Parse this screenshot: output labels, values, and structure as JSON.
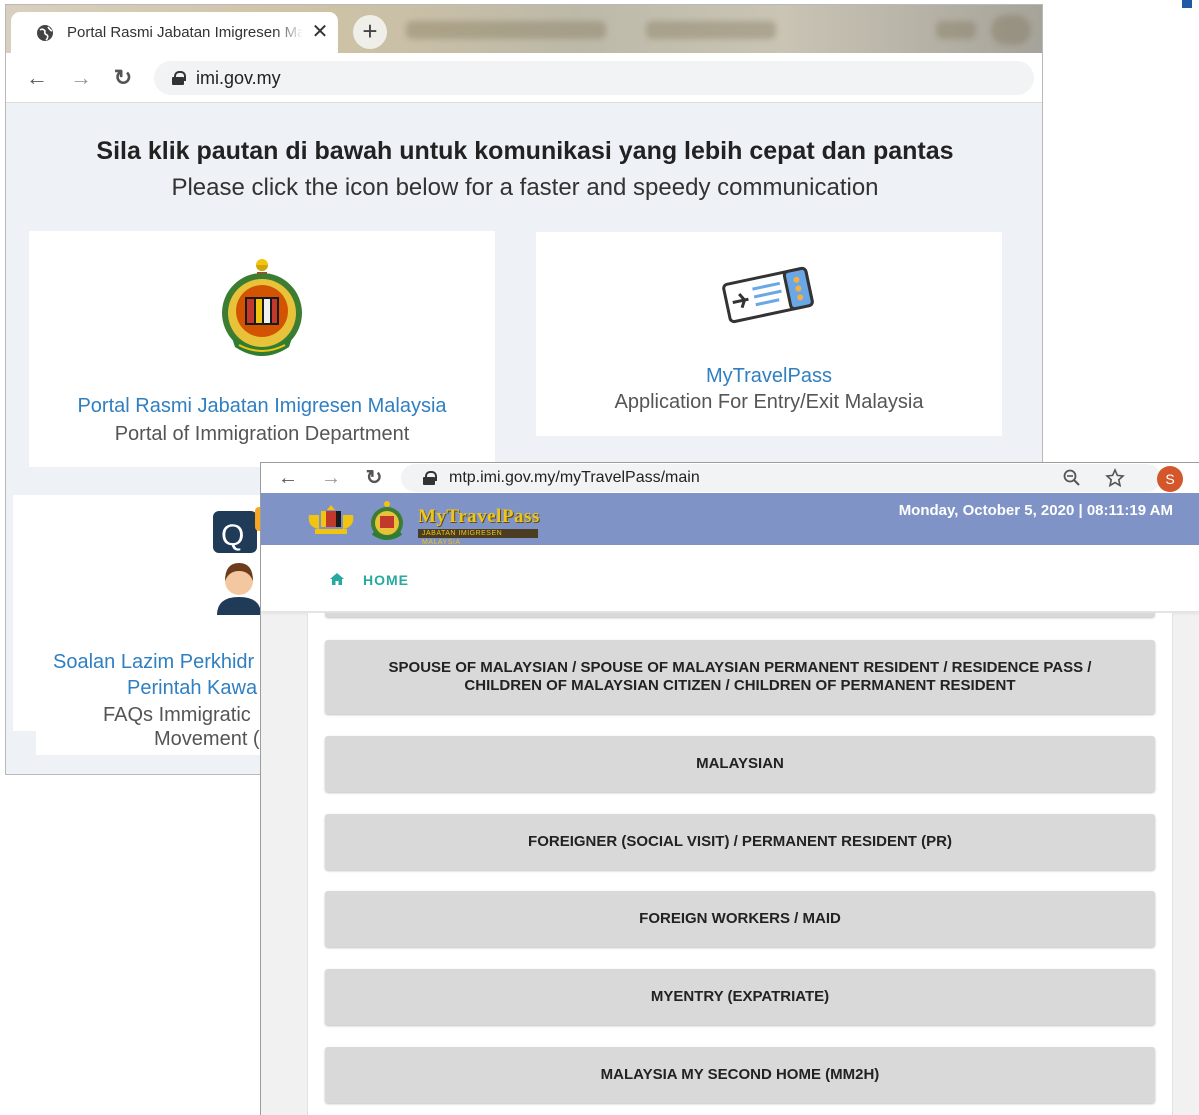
{
  "window_back": {
    "tab": {
      "title": "Portal Rasmi Jabatan Imigresen Malaysia",
      "close_glyph": "✕",
      "icon": "globe-icon"
    },
    "new_tab_glyph": "+",
    "toolbar": {
      "back_glyph": "←",
      "forward_glyph": "→",
      "reload_glyph": "↻",
      "url": "imi.gov.my"
    },
    "headline_ms": "Sila klik pautan di bawah untuk komunikasi yang lebih cepat dan pantas",
    "headline_en": "Please click the icon below for a faster and speedy communication",
    "cards": [
      {
        "title": "Portal Rasmi Jabatan Imigresen Malaysia",
        "subtitle": "Portal of Immigration Department",
        "icon": "immigration-crest-icon"
      },
      {
        "title": "MyTravelPass",
        "subtitle": "Application For Entry/Exit Malaysia",
        "icon": "boarding-pass-icon"
      },
      {
        "title_line1": "Soalan Lazim Perkhidr",
        "title_line2": "Perintah Kawa",
        "subtitle_line1": "FAQs Immigratic",
        "subtitle_line2": "Movement (",
        "icon": "faq-agent-icon"
      }
    ]
  },
  "window_front": {
    "toolbar": {
      "back_glyph": "←",
      "forward_glyph": "→",
      "reload_glyph": "↻",
      "url": "mtp.imi.gov.my/myTravelPass/main",
      "avatar_letter": "S"
    },
    "banner": {
      "brand": "MyTravelPass",
      "brand_sub": "JABATAN IMIGRESEN MALAYSIA",
      "datetime": "Monday, October 5, 2020 | 08:11:19 AM"
    },
    "nav": {
      "home_label": "HOME"
    },
    "options": [
      "SPOUSE OF MALAYSIAN / SPOUSE OF MALAYSIAN PERMANENT RESIDENT / RESIDENCE PASS / CHILDREN OF MALAYSIAN CITIZEN / CHILDREN OF PERMANENT RESIDENT",
      "MALAYSIAN",
      "FOREIGNER (SOCIAL VISIT) / PERMANENT RESIDENT (PR)",
      "FOREIGN WORKERS / MAID",
      "MYENTRY (EXPATRIATE)",
      "MALAYSIA MY SECOND HOME (MM2H)"
    ]
  },
  "colors": {
    "link_blue": "#2f7fc1",
    "banner_blue": "#7f93c7",
    "home_teal": "#27a9a2",
    "option_grey": "#d9d9d9",
    "avatar_orange": "#d4572b"
  }
}
